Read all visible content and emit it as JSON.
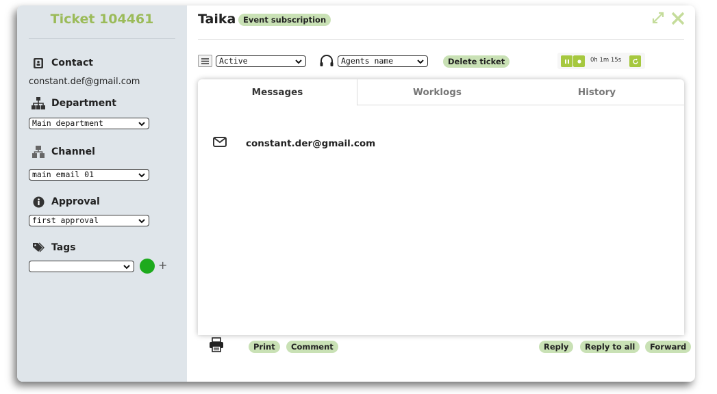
{
  "sidebar": {
    "ticket_title": "Ticket 104461",
    "contact": {
      "label": "Contact",
      "email": "constant.def@gmail.com",
      "icon": "contact-card-icon"
    },
    "department": {
      "label": "Department",
      "value": "Main department",
      "icon": "org-chart-icon"
    },
    "channel": {
      "label": "Channel",
      "value": "main email 01",
      "icon": "network-icon"
    },
    "approval": {
      "label": "Approval",
      "value": "first approval",
      "icon": "info-icon"
    },
    "tags": {
      "label": "Tags",
      "value": "",
      "color": "#1daa1d",
      "add": "+",
      "icon": "tag-icon"
    }
  },
  "header": {
    "title": "Taika",
    "badge": "Event subscription",
    "icons": [
      "expand-icon",
      "close-icon"
    ]
  },
  "toolbar": {
    "status": "Active",
    "agent": "Agents name",
    "delete_label": "Delete ticket",
    "timer": "0h 1m 15s"
  },
  "tabs": [
    {
      "label": "Messages",
      "active": true
    },
    {
      "label": "Worklogs",
      "active": false
    },
    {
      "label": "History",
      "active": false
    }
  ],
  "messages": [
    {
      "from": "constant.der@gmail.com",
      "icon": "envelope-icon"
    }
  ],
  "footer": {
    "print": "Print",
    "comment": "Comment",
    "reply": "Reply",
    "reply_all": "Reply to all",
    "forward": "Forward"
  },
  "colors": {
    "accent": "#9bbb59",
    "pill": "#c9e1b5",
    "sidebar": "#dfe5ea",
    "timer_btn": "#a6c83f"
  }
}
